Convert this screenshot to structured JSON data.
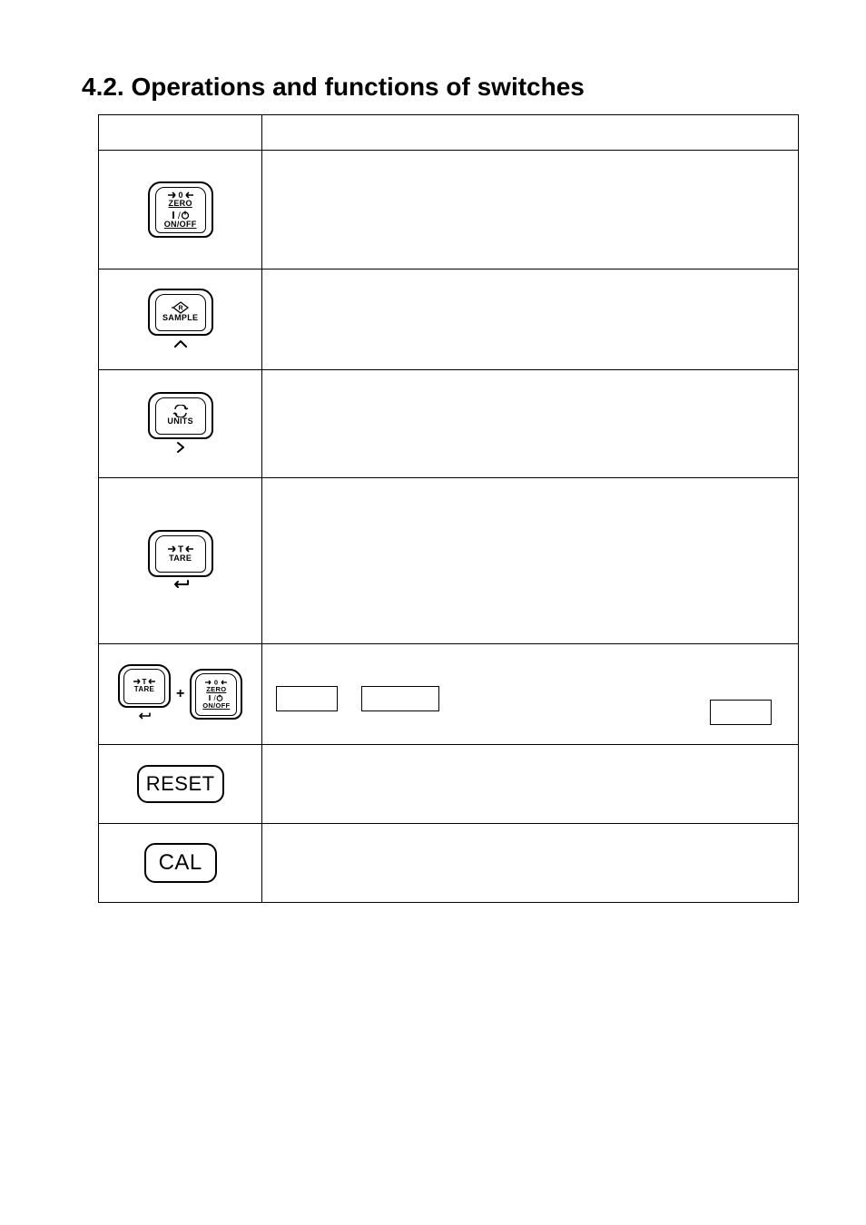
{
  "heading": "4.2. Operations and functions of switches",
  "keys": {
    "zero_onoff": {
      "top_symbol": "→0←",
      "top_label": "ZERO",
      "mid_symbol": "I/⏻",
      "bottom_label": "ON/OFF"
    },
    "sample": {
      "label": "SAMPLE",
      "nav": "︿"
    },
    "units": {
      "label": "UNITS",
      "nav": "›"
    },
    "tare": {
      "top_symbol": "→T←",
      "label": "TARE",
      "nav": "↩"
    },
    "reset": {
      "label": "RESET"
    },
    "cal": {
      "label": "CAL"
    }
  },
  "combo": {
    "plus": "+"
  },
  "row5": {
    "gap1": " ",
    "gap2": " ",
    "gap3": " "
  }
}
